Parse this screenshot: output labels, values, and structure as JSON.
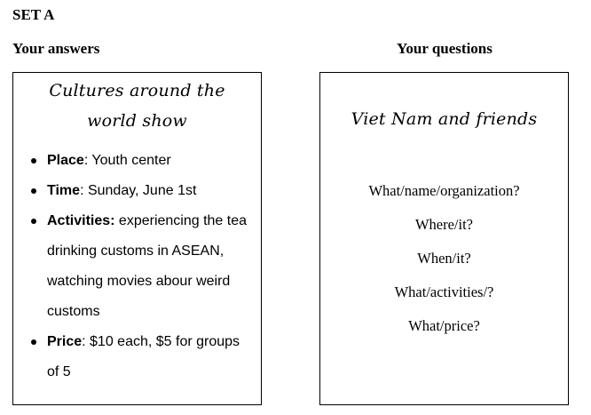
{
  "set_title": "SET A",
  "answers_heading": "Your answers",
  "questions_heading": "Your questions",
  "answers_card": {
    "title_line1": "Cultures around the",
    "title_line2": "world show",
    "items": [
      {
        "key": "Place",
        "text": ": Youth center"
      },
      {
        "key": "Time",
        "text": ": Sunday, June 1st"
      },
      {
        "key": "Activities:",
        "text": " experiencing the tea drinking customs in ASEAN, watching movies abour weird customs"
      },
      {
        "key": "Price",
        "text": ": $10 each, $5 for groups of 5"
      }
    ]
  },
  "questions_card": {
    "title": "Viet Nam and friends",
    "questions": [
      "What/name/organization?",
      "Where/it?",
      "When/it?",
      "What/activities/?",
      "What/price?"
    ]
  }
}
